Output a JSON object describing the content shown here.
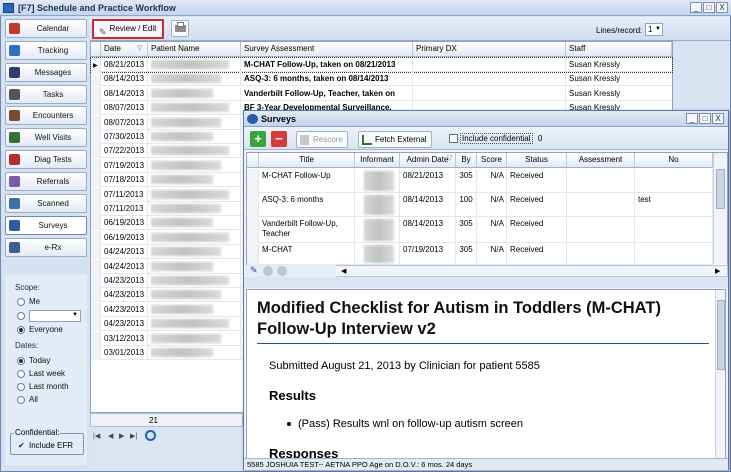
{
  "main_window": {
    "title": "[F7] Schedule and Practice Workflow",
    "win_min": "_",
    "win_max": "□",
    "win_close": "X"
  },
  "sidebar": {
    "items": [
      {
        "label": "Calendar",
        "icon": "calendar-icon",
        "color": "#c0392b"
      },
      {
        "label": "Tracking",
        "icon": "tracking-icon",
        "color": "#2e6fbf"
      },
      {
        "label": "Messages",
        "icon": "messages-icon",
        "color": "#2d3f6b"
      },
      {
        "label": "Tasks",
        "icon": "tasks-icon",
        "color": "#555555"
      },
      {
        "label": "Encounters",
        "icon": "encounters-icon",
        "color": "#7a4a2a"
      },
      {
        "label": "Well Visits",
        "icon": "well-visits-icon",
        "color": "#3b6f3b"
      },
      {
        "label": "Diag Tests",
        "icon": "diag-tests-icon",
        "color": "#b03030"
      },
      {
        "label": "Referrals",
        "icon": "referrals-icon",
        "color": "#7a5aa8"
      },
      {
        "label": "Scanned",
        "icon": "scanned-icon",
        "color": "#3d6fa8"
      },
      {
        "label": "Surveys",
        "icon": "surveys-icon",
        "color": "#2d5fa0"
      },
      {
        "label": "e-Rx",
        "icon": "erx-icon",
        "color": "#3d5d9a"
      }
    ],
    "scope_label": "Scope:",
    "scope_me": "Me",
    "scope_everyone": "Everyone",
    "dates_label": "Dates:",
    "date_options": [
      "Today",
      "Last week",
      "Last month",
      "All"
    ],
    "confidential_label": "Confidential:",
    "include_efr": "Include EFR",
    "check_mark": "✔"
  },
  "toolbar": {
    "review_edit": "Review / Edit",
    "lines_per_record_label": "Lines/record:",
    "lines_per_record_value": "1"
  },
  "main_table": {
    "columns": [
      "Date",
      "Patient Name",
      "Survey Assessment",
      "Primary DX",
      "Staff"
    ],
    "rows": [
      {
        "date": "08/21/2013",
        "assessment": "M-CHAT Follow-Up, taken on 08/21/2013",
        "staff": "Susan Kressly"
      },
      {
        "date": "08/14/2013",
        "assessment": "ASQ-3: 6 months, taken on 08/14/2013",
        "staff": "Susan Kressly"
      },
      {
        "date": "08/14/2013",
        "assessment": "Vanderbilt Follow-Up, Teacher, taken on",
        "staff": "Susan Kressly"
      },
      {
        "date": "08/07/2013",
        "assessment": "BF 3-Year Developmental Surveillance,",
        "staff": "Susan Kressly"
      },
      {
        "date": "08/07/2013",
        "assessment": "",
        "staff": ""
      },
      {
        "date": "07/30/2013",
        "assessment": "",
        "staff": ""
      },
      {
        "date": "07/22/2013",
        "assessment": "",
        "staff": ""
      },
      {
        "date": "07/19/2013",
        "assessment": "",
        "staff": ""
      },
      {
        "date": "07/18/2013",
        "assessment": "",
        "staff": ""
      },
      {
        "date": "07/11/2013",
        "assessment": "",
        "staff": ""
      },
      {
        "date": "07/11/2013",
        "assessment": "",
        "staff": ""
      },
      {
        "date": "06/19/2013",
        "assessment": "",
        "staff": ""
      },
      {
        "date": "06/19/2013",
        "assessment": "",
        "staff": ""
      },
      {
        "date": "04/24/2013",
        "assessment": "",
        "staff": ""
      },
      {
        "date": "04/24/2013",
        "assessment": "",
        "staff": ""
      },
      {
        "date": "04/23/2013",
        "assessment": "",
        "staff": ""
      },
      {
        "date": "04/23/2013",
        "assessment": "",
        "staff": ""
      },
      {
        "date": "04/23/2013",
        "assessment": "",
        "staff": ""
      },
      {
        "date": "04/23/2013",
        "assessment": "",
        "staff": ""
      },
      {
        "date": "03/12/2013",
        "assessment": "",
        "staff": ""
      },
      {
        "date": "03/01/2013",
        "assessment": "",
        "staff": ""
      }
    ],
    "record_count": "21",
    "sort_arrow": "▽",
    "row_pointer": "▶",
    "nav_first": "|◀",
    "nav_prev": "◀",
    "nav_next": "▶",
    "nav_last": "▶|"
  },
  "surveys_window": {
    "title": "Surveys",
    "win_min": "_",
    "win_max": "□",
    "win_close": "X",
    "toolbar": {
      "add": "+",
      "remove": "−",
      "rescore": "Rescore",
      "fetch_external": "Fetch External",
      "include_confidential": "Include confidential",
      "confidential_count": "0"
    },
    "columns": [
      "Title",
      "Informant",
      "Admin Date",
      "By",
      "Score",
      "Status",
      "Assessment",
      "No"
    ],
    "rows": [
      {
        "title": "M-CHAT Follow-Up",
        "date": "08/21/2013",
        "by": "305",
        "score": "N/A",
        "status": "Received",
        "note": ""
      },
      {
        "title": "ASQ-3: 6 months",
        "date": "08/14/2013",
        "by": "100",
        "score": "N/A",
        "status": "Received",
        "note": "test"
      },
      {
        "title": "Vanderbilt Follow-Up, Teacher",
        "date": "08/14/2013",
        "by": "305",
        "score": "N/A",
        "status": "Received",
        "note": ""
      },
      {
        "title": "M-CHAT",
        "date": "07/19/2013",
        "by": "305",
        "score": "N/A",
        "status": "Received",
        "note": ""
      }
    ],
    "report": {
      "heading": "Modified Checklist for Autism in Toddlers (M-CHAT) Follow-Up Interview v2",
      "submitted": "Submitted August 21, 2013 by Clinician for patient 5585",
      "results_heading": "Results",
      "result_item": "(Pass) Results wnl on follow-up autism screen",
      "responses_heading": "Responses"
    },
    "status_bar": "5585 JOSHUIA TEST-- AETNA PPO  Age on D.O.V.: 6 mos. 24 days"
  }
}
